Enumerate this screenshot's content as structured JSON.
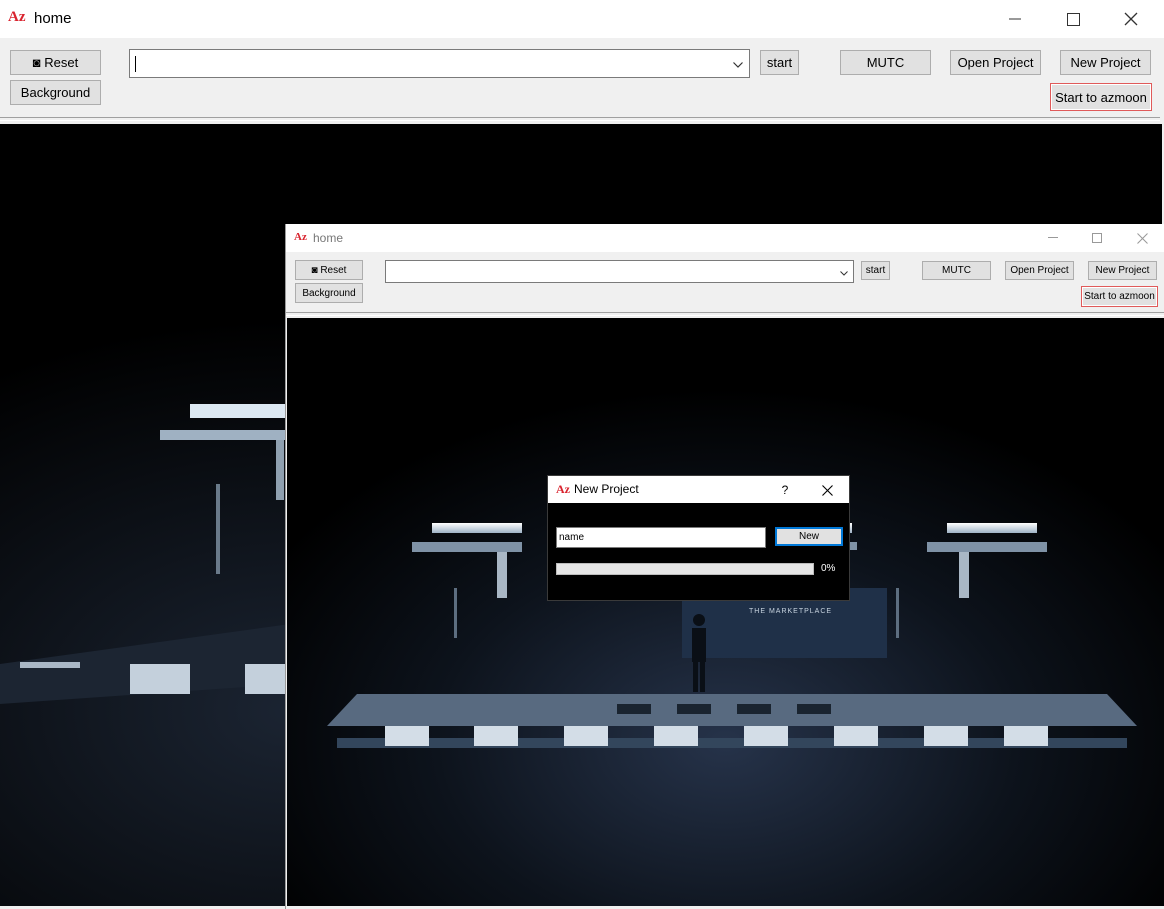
{
  "app_icon": "Az",
  "main_window": {
    "title": "home",
    "toolbar": {
      "reset_label": "◙ Reset",
      "background_label": "Background",
      "search_value": "",
      "start_label": "start",
      "mutc_label": "MUTC",
      "open_project_label": "Open Project",
      "new_project_label": "New Project",
      "start_azmoon_label": "Start to azmoon"
    }
  },
  "inner_window": {
    "title": "home",
    "toolbar": {
      "reset_label": "◙ Reset",
      "background_label": "Background",
      "search_value": "",
      "start_label": "start",
      "mutc_label": "MUTC",
      "open_project_label": "Open Project",
      "new_project_label": "New Project",
      "start_azmoon_label": "Start to azmoon"
    }
  },
  "dialog": {
    "title": "New Project",
    "help_label": "?",
    "name_value": "name",
    "new_label": "New",
    "progress_percent": 0,
    "progress_text": "0%"
  },
  "background_image": {
    "sign_text": "THE MARKETPLACE"
  },
  "colors": {
    "accent_red": "#d9232e",
    "focus_blue": "#0078d7",
    "window_bg": "#f0f0f0",
    "button_bg": "#e1e1e1"
  }
}
